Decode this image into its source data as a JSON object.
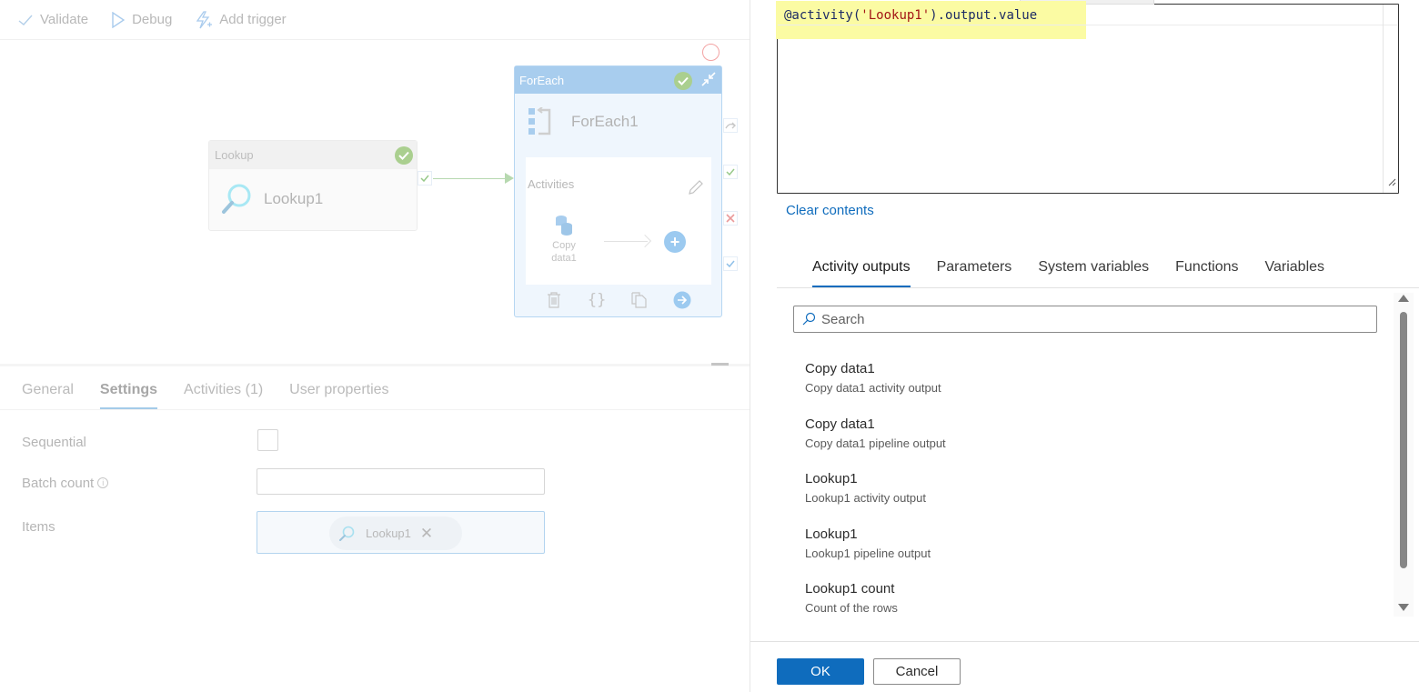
{
  "toolbar": {
    "validate_label": "Validate",
    "debug_label": "Debug",
    "add_trigger_label": "Add trigger"
  },
  "canvas": {
    "lookup_node": {
      "type_label": "Lookup",
      "name": "Lookup1",
      "status": "succeeded"
    },
    "foreach_node": {
      "type_label": "ForEach",
      "name": "ForEach1",
      "activities_label": "Activities",
      "inner_activity": "Copy data1",
      "status": "succeeded"
    }
  },
  "properties": {
    "tabs": [
      {
        "label": "General",
        "active": false
      },
      {
        "label": "Settings",
        "active": true
      },
      {
        "label": "Activities (1)",
        "active": false
      },
      {
        "label": "User properties",
        "active": false
      }
    ],
    "sequential_label": "Sequential",
    "sequential_checked": false,
    "batch_count_label": "Batch count",
    "batch_count_value": "",
    "items_label": "Items",
    "items_chip": "Lookup1"
  },
  "expression_builder": {
    "expression": {
      "prefix": "@activity(",
      "string_arg": "'Lookup1'",
      "suffix": ").output.value"
    },
    "clear_contents_label": "Clear contents",
    "tabs": [
      {
        "label": "Activity outputs",
        "active": true
      },
      {
        "label": "Parameters",
        "active": false
      },
      {
        "label": "System variables",
        "active": false
      },
      {
        "label": "Functions",
        "active": false
      },
      {
        "label": "Variables",
        "active": false
      }
    ],
    "search_placeholder": "Search",
    "items": [
      {
        "title": "Copy data1",
        "subtitle": "Copy data1 activity output"
      },
      {
        "title": "Copy data1",
        "subtitle": "Copy data1 pipeline output"
      },
      {
        "title": "Lookup1",
        "subtitle": "Lookup1 activity output"
      },
      {
        "title": "Lookup1",
        "subtitle": "Lookup1 pipeline output"
      },
      {
        "title": "Lookup1 count",
        "subtitle": "Count of the rows"
      }
    ],
    "ok_label": "OK",
    "cancel_label": "Cancel"
  },
  "colors": {
    "accent": "#0f6cbd",
    "success": "#aacf8f",
    "highlight": "#fbfba3"
  }
}
